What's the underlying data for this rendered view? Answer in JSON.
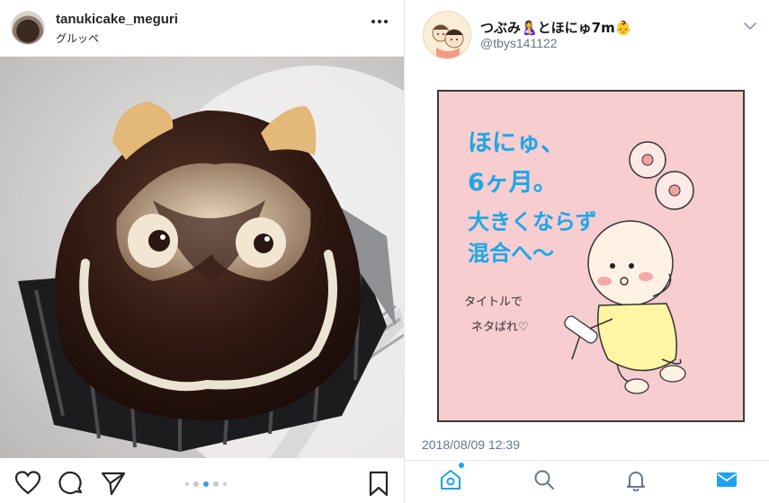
{
  "instagram": {
    "username": "tanukicake_meguri",
    "location": "グルッペ",
    "more_icon": "more-horizontal-icon",
    "photo_subject": "tanuki-cake",
    "carousel": {
      "count": 5,
      "active_index": 2
    },
    "icons": [
      "heart-icon",
      "comment-icon",
      "share-icon",
      "bookmark-icon"
    ]
  },
  "twitter": {
    "display_name": "つぶみ🤱とほにゅ7m👶",
    "handle": "@tbys141122",
    "timestamp": "2018/08/09 12:39",
    "illustration": {
      "bg_color": "#f7cdd0",
      "text_color": "#1ea7e8",
      "lines": [
        "ほにゅ、",
        "6ヶ月。",
        "大きくならず",
        "混合へ〜"
      ],
      "note_lines": [
        "タイトルで",
        "ネタばれ♡"
      ]
    },
    "nav_icons": [
      "home-icon",
      "search-icon",
      "notifications-icon",
      "messages-icon"
    ],
    "accent": "#1da1f2"
  }
}
